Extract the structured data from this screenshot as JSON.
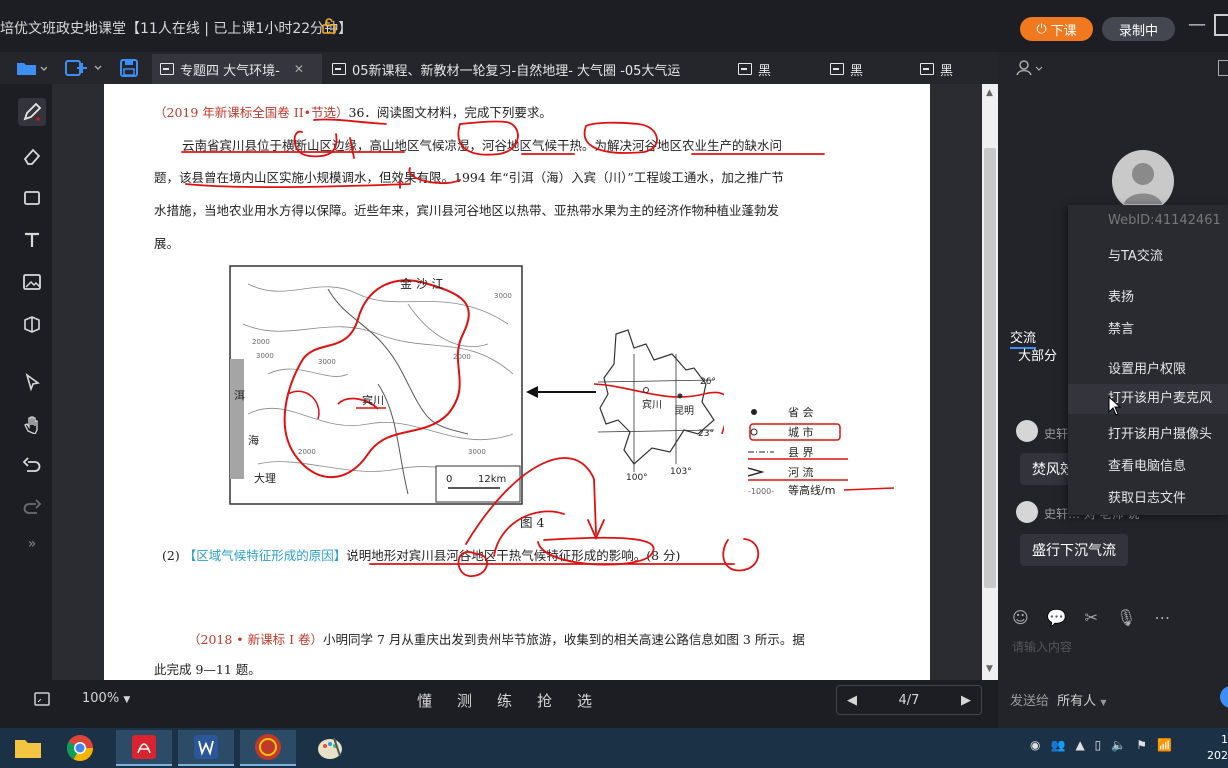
{
  "window": {
    "title": "培优文班政史地课堂【11人在线 | 已上课1小时22分钟】",
    "end_class_label": "下课",
    "recording_label": "录制中"
  },
  "tabs": [
    {
      "label": "专题四 大气环境-",
      "active": true
    },
    {
      "label": "05新课程、新教材一轮复习-自然地理- 大气圈 -05大气运",
      "active": false
    },
    {
      "label": "黑",
      "active": false
    },
    {
      "label": "黑",
      "active": false
    },
    {
      "label": "黑",
      "active": false
    }
  ],
  "document": {
    "q1_source": "（2019 年新课标全国卷 II•节选）",
    "q1_intro": "36．阅读图文材料，完成下列要求。",
    "para_line1": "云南省宾川县位于横断山区边缘，高山地区气候凉湿，河谷地区气候干热。为解决河谷地区农业生产的缺水问",
    "para_line2": "题，该县曾在境内山区实施小规模调水，但效果有限。1994 年“引洱（海）入宾（川）”工程竣工通水，加之推广节",
    "para_line3": "水措施，当地农业用水方得以保障。近些年来，宾川县河谷地区以热带、亚热带水果为主的经济作物种植业蓬勃发",
    "para_line4": "展。",
    "map": {
      "river_top": "金 沙 江",
      "lake_a": "洱",
      "lake_b": "海",
      "city_dali": "大理",
      "county_binchuan": "宾川",
      "scale_zero": "0",
      "scale_km": "12km",
      "contours": [
        "3000",
        "2000",
        "3000",
        "3000",
        "2000",
        "2000",
        "3000"
      ],
      "inset_binchuan": "宾川",
      "inset_kunming": "昆明",
      "lat_26": "26°",
      "lat_23": "23°",
      "lon_100": "100°",
      "lon_103": "103°",
      "caption": "图 4"
    },
    "legend": {
      "capital": "省 会",
      "city": "城 市",
      "county_border": "县 界",
      "river": "河 流",
      "contour_sample": "-1000-",
      "contour_label": "等高线/m"
    },
    "q2_num": "(2)",
    "q2_tag": "【区域气候特征形成的原因】",
    "q2_text": "说明地形对宾川县河谷地区干热气候特征形成的影响。(8 分)",
    "q3_source": "（2018 • 新课标 I 卷）",
    "q3_line1": "小明同学 7 月从重庆出发到贵州毕节旅游，收集到的相关高速公路信息如图 3 所示。据",
    "q3_line2": "此完成 9—11 题。"
  },
  "bottom": {
    "zoom": "100%",
    "tools": [
      "懂",
      "测",
      "练",
      "抢",
      "选"
    ],
    "page_indicator": "4/7"
  },
  "side": {
    "chat_tab": "交流",
    "chat_partial": "大部分",
    "messages": [
      {
        "name": "史轩",
        "text": "焚风效"
      },
      {
        "name": "史轩… 对 老师 说",
        "text": "盛行下沉气流"
      }
    ],
    "input_placeholder": "请输入内容",
    "send_to_label": "发送给",
    "send_to_value": "所有人"
  },
  "context_menu": {
    "webid": "WebID:41142461",
    "items": [
      "与TA交流",
      "表扬",
      "禁言",
      "设置用户权限",
      "打开该用户麦克风",
      "打开该用户摄像头",
      "查看电脑信息",
      "获取日志文件"
    ],
    "hover_index": 4
  },
  "taskbar": {
    "clock_line1": "1",
    "clock_line2": "202"
  },
  "colors": {
    "accent_orange": "#f0781e",
    "annotation_red": "#e01010",
    "tag_blue": "#2aa1c8",
    "source_red": "#c0392b"
  }
}
